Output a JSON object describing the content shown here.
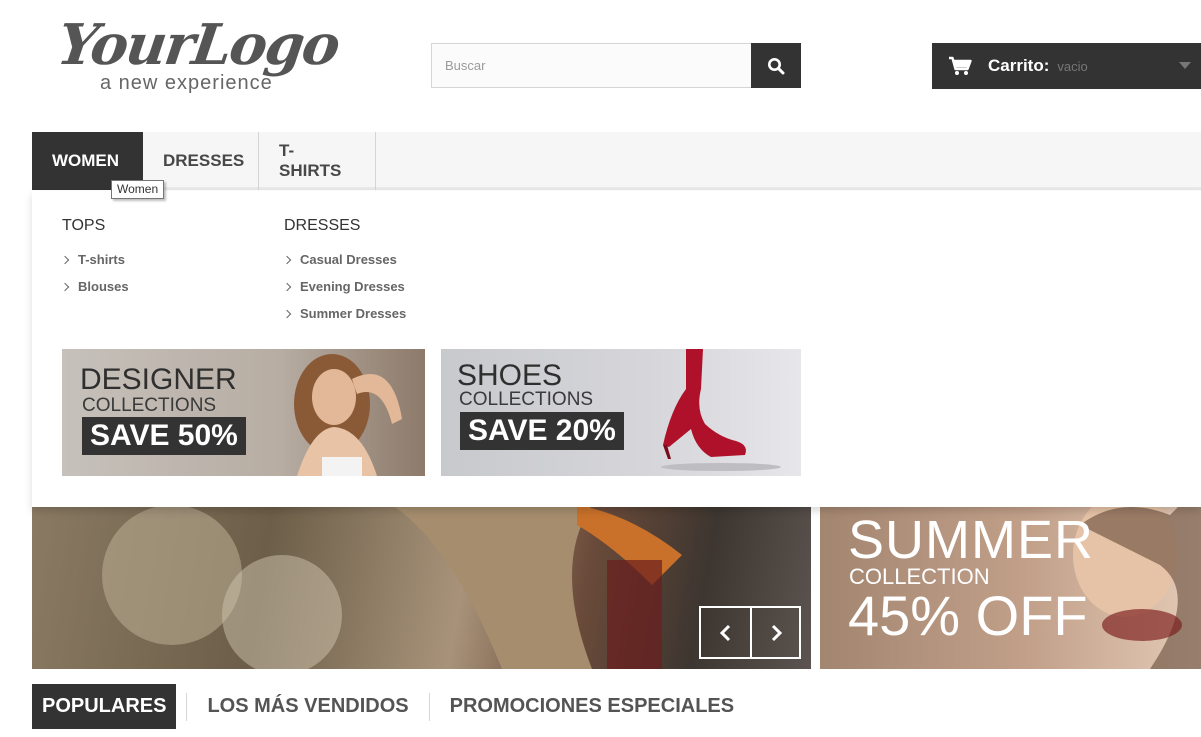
{
  "header": {
    "logo": {
      "main": "YourLogo",
      "tagline": "a new experience"
    },
    "search": {
      "placeholder": "Buscar",
      "icon": "search-icon"
    },
    "cart": {
      "label": "Carrito:",
      "status": "vacio",
      "icon": "cart-icon"
    }
  },
  "nav": {
    "items": [
      {
        "label": "WOMEN",
        "active": true
      },
      {
        "label": "DRESSES",
        "active": false
      },
      {
        "label": "T-SHIRTS",
        "active": false
      }
    ],
    "tooltip": "Women"
  },
  "dropdown": {
    "columns": [
      {
        "title": "TOPS",
        "links": [
          "T-shirts",
          "Blouses"
        ]
      },
      {
        "title": "DRESSES",
        "links": [
          "Casual Dresses",
          "Evening Dresses",
          "Summer Dresses"
        ]
      }
    ],
    "banners": [
      {
        "title": "DESIGNER",
        "subtitle": "COLLECTIONS",
        "save": "SAVE 50%"
      },
      {
        "title": "SHOES",
        "subtitle": "COLLECTIONS",
        "save": "SAVE 20%"
      }
    ]
  },
  "promo": {
    "title": "SUMMER",
    "subtitle": "COLLECTION",
    "discount": "45% OFF"
  },
  "tabs": [
    {
      "label": "POPULARES",
      "active": true
    },
    {
      "label": "LOS MÁS VENDIDOS",
      "active": false
    },
    {
      "label": "PROMOCIONES ESPECIALES",
      "active": false
    }
  ],
  "colors": {
    "dark": "#333333",
    "nav_bg": "#f6f6f6",
    "border": "#d6d4d4",
    "shoe_red": "#b0112a"
  }
}
